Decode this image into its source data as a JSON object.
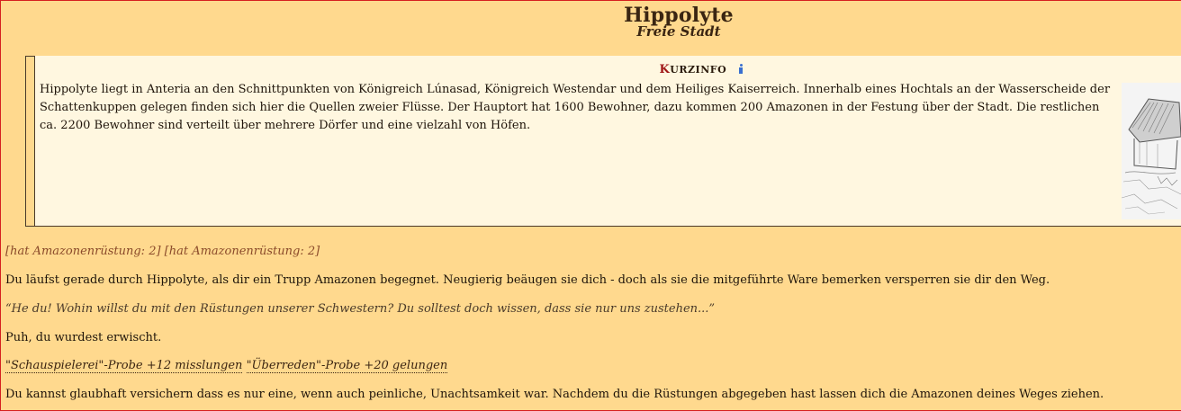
{
  "header": {
    "title": "Hippolyte",
    "subtitle": "Freie Stadt"
  },
  "kurzinfo": {
    "title_initial": "K",
    "title_rest": "URZINFO",
    "info_icon": "info-icon",
    "text": "Hippolyte liegt in Anteria an den Schnittpunkten von Königreich Lúnasad, Königreich Westendar und dem Heiliges Kaiserreich. Innerhalb eines Hochtals an der Wasserscheide der Schattenkuppen gelegen finden sich hier die Quellen zweier Flüsse. Der Hauptort hat 1600 Bewohner, dazu kommen 200 Amazonen in der Festung über der Stadt. Die restlichen ca. 2200 Bewohner sind verteilt über mehrere Dörfer und eine vielzahl von Höfen."
  },
  "log": {
    "tag": "[hat Amazonenrüstung: 2] [hat Amazonenrüstung: 2]",
    "paragraph1": "Du läufst gerade durch Hippolyte, als dir ein Trupp Amazonen begegnet. Neugierig beäugen sie dich - doch als sie die mitgeführte Ware bemerken versperren sie dir den Weg.",
    "quote": "“He du! Wohin willst du mit den Rüstungen unserer Schwestern? Du solltest doch wissen, dass sie nur uns zustehen...”",
    "paragraph2": "Puh, du wurdest erwischt.",
    "check1": "\"Schauspielerei\"-Probe +12 misslungen",
    "check2": "\"Überreden\"-Probe +20 gelungen",
    "paragraph3": "Du kannst glaubhaft versichern dass es nur eine, wenn auch peinliche, Unachtsamkeit war. Nachdem du die Rüstungen abgegeben hast lassen dich die Amazonen deines Weges ziehen."
  },
  "colors": {
    "background": "#ffd98e",
    "infobox": "#fff7e0",
    "accent_red": "#a01818",
    "tag_text": "#8a4a2a"
  }
}
